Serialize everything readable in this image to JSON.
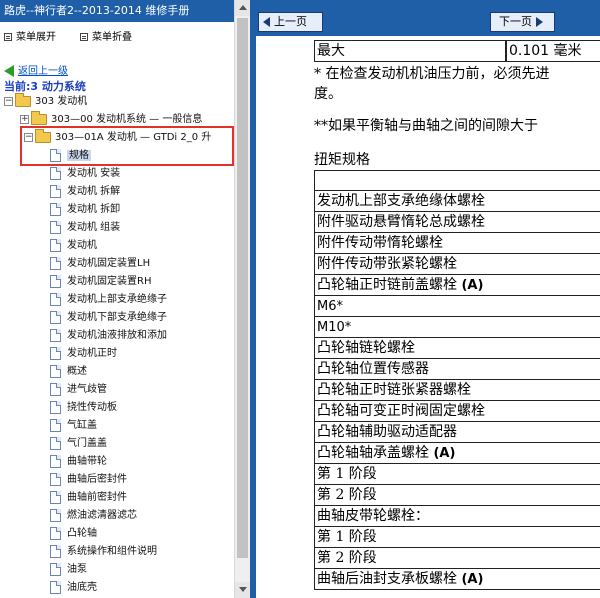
{
  "left_pane": {
    "title": "路虎--神行者2--2013-2014 维修手册",
    "toolbar": {
      "expand_label": "菜单展开",
      "collapse_label": "菜单折叠"
    },
    "back_link": "返回上一级",
    "current_label": "当前:3 动力系统",
    "tree": {
      "root": "303 发动机",
      "child1": "303—00 发动机系统 — 一般信息",
      "child2": "303—01A 发动机 — GTDi 2_0 升",
      "leaves": [
        "规格",
        "发动机 安装",
        "发动机 拆解",
        "发动机 拆卸",
        "发动机 组装",
        "发动机",
        "发动机固定装置LH",
        "发动机固定装置RH",
        "发动机上部支承绝缘子",
        "发动机下部支承绝缘子",
        "发动机油液排放和添加",
        "发动机正时",
        "概述",
        "进气歧管",
        "挠性传动板",
        "气缸盖",
        "气门盖盖",
        "曲轴带轮",
        "曲轴后密封件",
        "曲轴前密封件",
        "燃油滤清器滤芯",
        "凸轮轴",
        "系统操作和组件说明",
        "油泵",
        "油底壳"
      ]
    }
  },
  "nav": {
    "prev_label": "上一页",
    "next_label": "下一页"
  },
  "content": {
    "row1_label": "最大",
    "row1_value": "0.101 毫米",
    "note1_line1": "* 在检查发动机机油压力前，必须先进",
    "note1_line2": "度。",
    "note2": "**如果平衡轴与曲轴之间的间隙大于",
    "torque_heading": "扭矩规格",
    "torque_rows": [
      "",
      "发动机上部支承绝缘体螺栓",
      "附件驱动悬臂惰轮总成螺栓",
      "附件传动带惰轮螺栓",
      "附件传动带张紧轮螺栓",
      "凸轮轴正时链前盖螺栓 (A)",
      "M6*",
      "M10*",
      "凸轮轴链轮螺栓",
      "凸轮轴位置传感器",
      "凸轮轴正时链张紧器螺栓",
      "凸轮轴可变正时阀固定螺栓",
      "凸轮轴辅助驱动适配器",
      "凸轮轴轴承盖螺栓 (A)",
      "第 1 阶段",
      "第 2 阶段",
      "曲轴皮带轮螺栓：",
      "第 1 阶段",
      "第 2 阶段",
      "曲轴后油封支承板螺栓 (A)"
    ]
  }
}
